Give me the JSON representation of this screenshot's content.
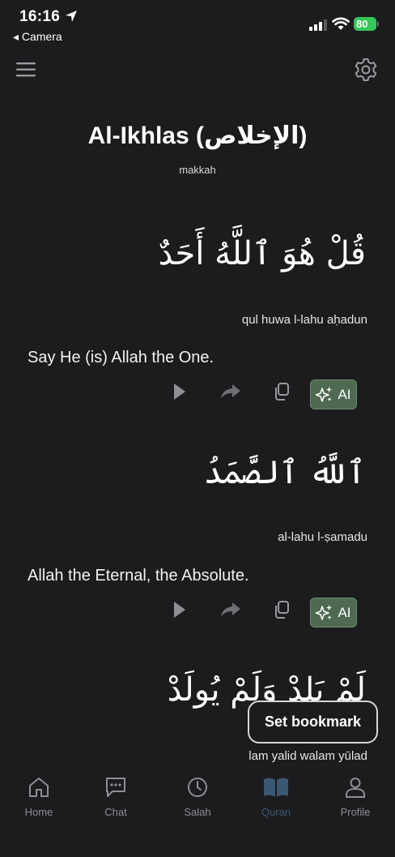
{
  "status": {
    "time": "16:16",
    "back_app": "◂ Camera",
    "battery": "80"
  },
  "header": {
    "menu_icon": "hamburger-icon",
    "settings_icon": "gear-icon"
  },
  "surah": {
    "title": "Al-Ikhlas (الإخلاص)",
    "revelation": "makkah"
  },
  "verses": [
    {
      "arabic": "قُلْ هُوَ ٱللَّهُ أَحَدٌ",
      "transliteration": "qul huwa l-lahu aḥadun",
      "translation": "Say He (is) Allah the One."
    },
    {
      "arabic": "ٱللَّهُ ٱلصَّمَدُ",
      "transliteration": "al-lahu l-ṣamadu",
      "translation": "Allah the Eternal, the Absolute."
    },
    {
      "arabic": "لَمْ يَلِدْ وَلَمْ يُولَدْ",
      "transliteration": "lam yalid walam yūlad",
      "translation": ""
    }
  ],
  "actions": {
    "ai_label": "AI"
  },
  "bookmark": {
    "label": "Set bookmark"
  },
  "tabs": [
    {
      "label": "Home",
      "icon": "home-icon"
    },
    {
      "label": "Chat",
      "icon": "chat-icon"
    },
    {
      "label": "Salah",
      "icon": "clock-icon"
    },
    {
      "label": "Quran",
      "icon": "book-icon",
      "active": true
    },
    {
      "label": "Profile",
      "icon": "user-icon"
    }
  ],
  "colors": {
    "background": "#1c1c1e",
    "ai_button": "#4e6a52",
    "active_tab": "#3b5872",
    "inactive_tab": "#8e8e93"
  }
}
